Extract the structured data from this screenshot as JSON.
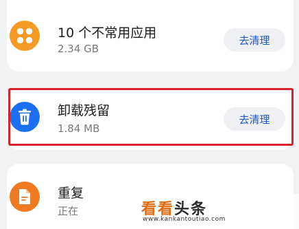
{
  "items": [
    {
      "title": "10 个不常用应用",
      "size": "2.34 GB",
      "button": "去清理",
      "icon": "apps-grid-icon"
    },
    {
      "title": "卸载残留",
      "size": "1.84 MB",
      "button": "去清理",
      "icon": "trash-icon"
    },
    {
      "title": "重复",
      "size": "正在",
      "icon": "document-icon"
    }
  ],
  "watermark": {
    "brand_a": "看看",
    "brand_b": "头条",
    "url": "www.kankantoutiao.com"
  },
  "colors": {
    "orange_icon": "#f59a24",
    "blue_icon": "#1d6ff2",
    "doc_icon": "#f07a22",
    "button_text": "#1d56c9",
    "highlight": "#d8232a"
  }
}
